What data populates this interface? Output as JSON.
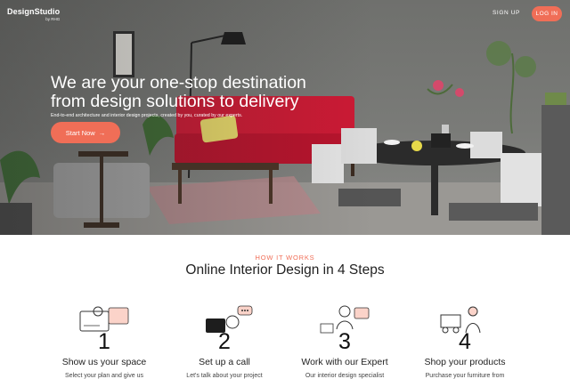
{
  "header": {
    "brand": "DesignStudio",
    "brand_sub": "by RHG",
    "signup_label": "SIGN UP",
    "login_label": "LOG IN"
  },
  "hero": {
    "headline_line1": "We are your one-stop destination",
    "headline_line2": "from design solutions to delivery",
    "subline": "End-to-end architecture and interior design projects, created by you, curated by our experts.",
    "cta_label": "Start Now",
    "cta_icon": "arrow-right-icon",
    "arrow_glyph": "→"
  },
  "how_it_works": {
    "eyebrow": "HOW IT WORKS",
    "title": "Online Interior Design in 4 Steps",
    "steps": [
      {
        "number": "1",
        "title": "Show us your space",
        "desc": "Select your plan and give us",
        "icon": "room-photo-icon"
      },
      {
        "number": "2",
        "title": "Set up a call",
        "desc": "Let's talk about your project",
        "icon": "video-call-icon"
      },
      {
        "number": "3",
        "title": "Work with our Expert",
        "desc": "Our interior design specialist",
        "icon": "designer-at-desk-icon"
      },
      {
        "number": "4",
        "title": "Shop your products",
        "desc": "Purchase your furniture from",
        "icon": "delivery-shopping-icon"
      }
    ]
  },
  "colors": {
    "accent": "#f06e57",
    "sofa": "#cc1a34",
    "wall": "#737471"
  }
}
